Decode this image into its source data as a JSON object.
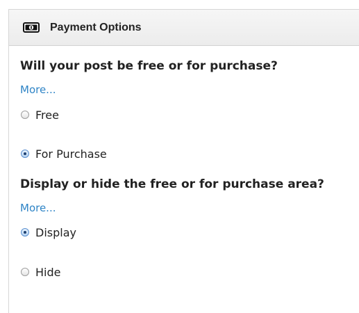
{
  "header": {
    "title": "Payment Options",
    "icon": "money-icon"
  },
  "section1": {
    "question": "Will your post be free or for purchase?",
    "more_label": "More...",
    "options": [
      {
        "label": "Free",
        "checked": false
      },
      {
        "label": "For Purchase",
        "checked": true
      }
    ]
  },
  "section2": {
    "question": "Display or hide the free or for purchase area?",
    "more_label": "More...",
    "options": [
      {
        "label": "Display",
        "checked": true
      },
      {
        "label": "Hide",
        "checked": false
      }
    ]
  },
  "colors": {
    "link": "#2e84c6",
    "header_bg": "#f0f0f0",
    "border": "#d6d6d6"
  }
}
